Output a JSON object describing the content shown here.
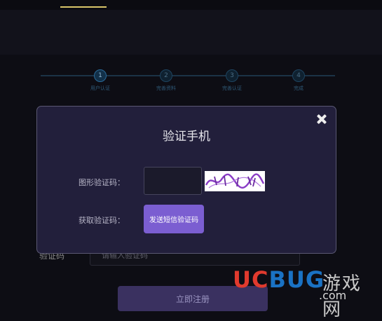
{
  "steps": [
    {
      "num": "1",
      "label": "用户认证"
    },
    {
      "num": "2",
      "label": "完善资料"
    },
    {
      "num": "3",
      "label": "完善认证"
    },
    {
      "num": "4",
      "label": "完成"
    }
  ],
  "form": {
    "verify_label": "验证码",
    "verify_placeholder": "请输入验证码",
    "register_button": "立即注册"
  },
  "dialog": {
    "title": "验证手机",
    "captcha_label": "图形验证码：",
    "sms_label": "获取验证码：",
    "sms_button": "发送短信验证码"
  },
  "watermark": {
    "uc": "UC",
    "bug": "BUG",
    "cn": "游戏网",
    "com": ".com"
  },
  "colors": {
    "accent": "#7b5ed1",
    "dialog_bg": "#221f3b",
    "tab_underline": "#d8c56a"
  }
}
